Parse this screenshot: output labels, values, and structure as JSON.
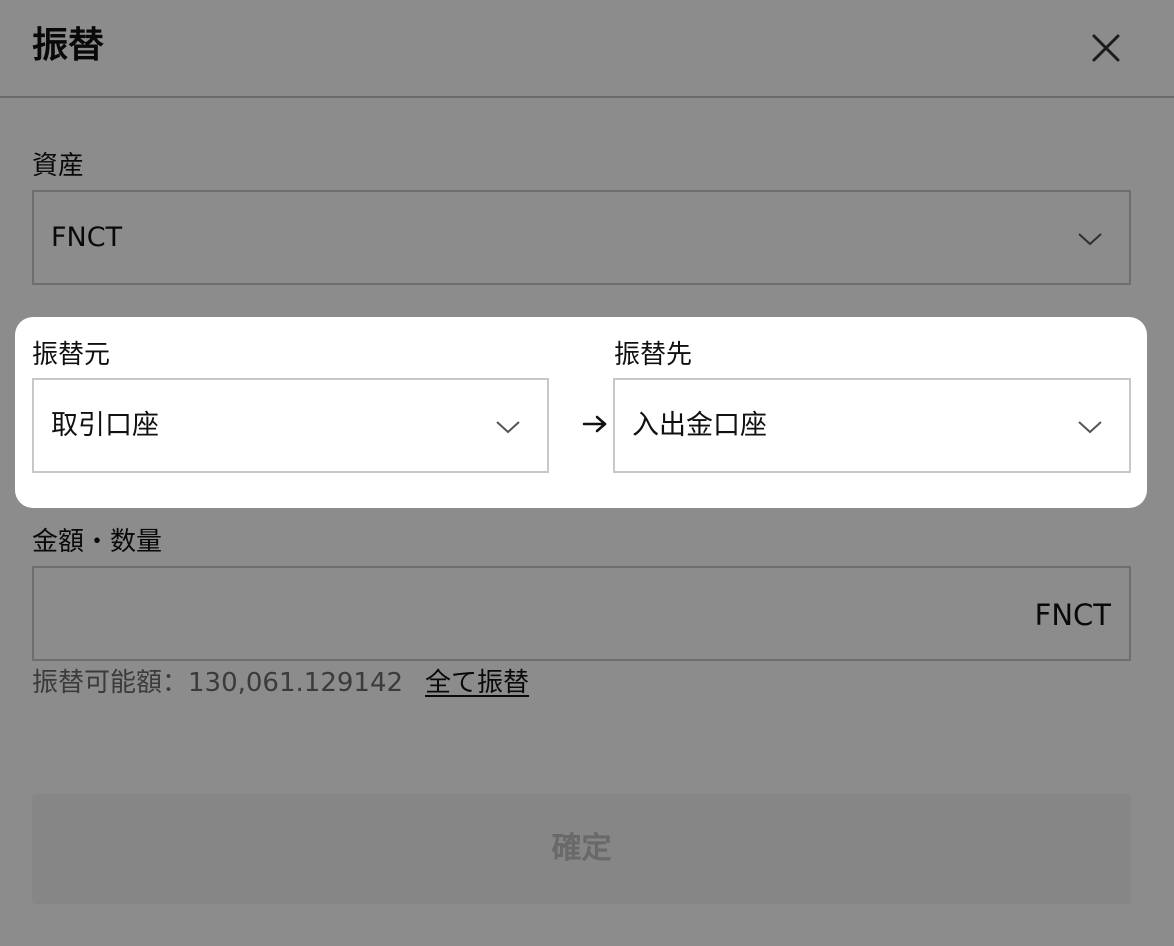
{
  "dialog": {
    "title": "振替",
    "close_icon": "close-icon"
  },
  "asset": {
    "label": "資産",
    "value": "FNCT"
  },
  "from": {
    "label": "振替元",
    "value": "取引口座"
  },
  "to": {
    "label": "振替先",
    "value": "入出金口座"
  },
  "amount": {
    "label": "金額・数量",
    "value": "",
    "unit": "FNCT"
  },
  "available": {
    "text": "振替可能額：130,061.129142",
    "transfer_all_label": "全て振替"
  },
  "confirm": {
    "label": "確定"
  },
  "colors": {
    "overlay": "#000000",
    "border": "#c8c8c8",
    "disabled_text": "#c0c0c0"
  }
}
